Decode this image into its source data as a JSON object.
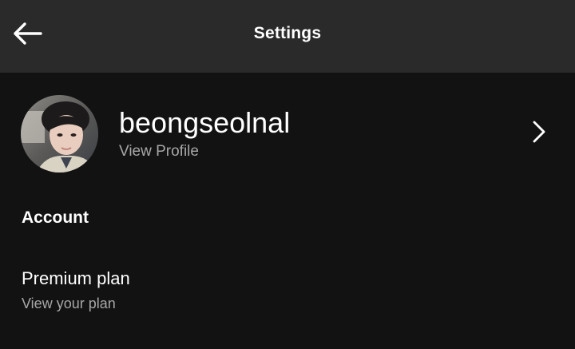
{
  "header": {
    "title": "Settings",
    "back_icon": "arrow-left-icon"
  },
  "profile": {
    "name": "beongseolnal",
    "subtitle": "View Profile",
    "chevron_icon": "chevron-right-icon"
  },
  "account": {
    "heading": "Account",
    "items": [
      {
        "title": "Premium plan",
        "subtitle": "View your plan"
      }
    ]
  },
  "colors": {
    "background": "#121212",
    "header_background": "#2a2a2a",
    "primary_text": "#ffffff",
    "secondary_text": "#a7a7a7"
  }
}
